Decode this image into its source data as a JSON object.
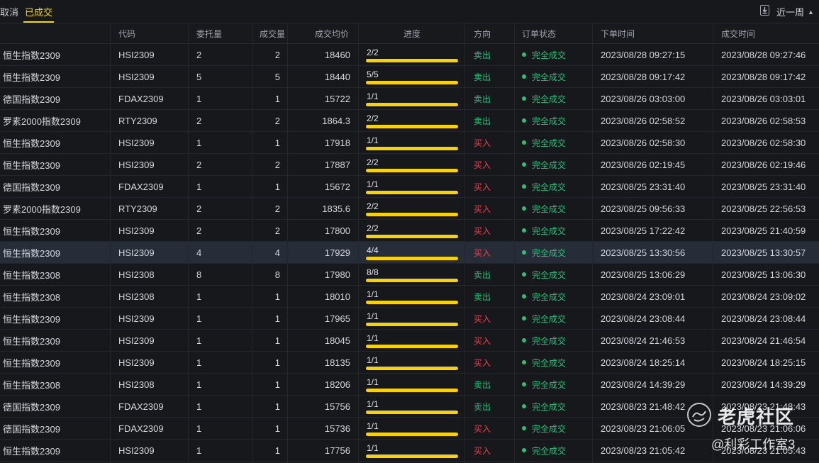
{
  "tabs": {
    "cancelled": "取消",
    "filled": "已成交"
  },
  "toolbar": {
    "export_icon": "download-icon",
    "period": "近一周",
    "period_caret": "▲"
  },
  "columns": {
    "name": "",
    "code": "代码",
    "order_qty": "委托量",
    "filled_qty": "成交量",
    "avg_price": "成交均价",
    "progress": "进度",
    "direction": "方向",
    "status": "订单状态",
    "placed_time": "下单时间",
    "filled_time": "成交时间"
  },
  "colors": {
    "accent": "#f3d21e",
    "sell": "#27c37a",
    "buy": "#f2404c",
    "progress": "#f5d10f"
  },
  "rows": [
    {
      "name": "恒生指数2309",
      "code": "HSI2309",
      "qty": "2",
      "filled": "2",
      "price": "18460",
      "progress": "2/2",
      "fill": 1,
      "dir": "卖出",
      "side": "sell",
      "status": "完全成交",
      "placed": "2023/08/28 09:27:15",
      "done": "2023/08/28 09:27:46",
      "selected": false
    },
    {
      "name": "恒生指数2309",
      "code": "HSI2309",
      "qty": "5",
      "filled": "5",
      "price": "18440",
      "progress": "5/5",
      "fill": 1,
      "dir": "卖出",
      "side": "sell",
      "status": "完全成交",
      "placed": "2023/08/28 09:17:42",
      "done": "2023/08/28 09:17:42",
      "selected": false
    },
    {
      "name": "德国指数2309",
      "code": "FDAX2309",
      "qty": "1",
      "filled": "1",
      "price": "15722",
      "progress": "1/1",
      "fill": 1,
      "dir": "卖出",
      "side": "sell",
      "status": "完全成交",
      "placed": "2023/08/26 03:03:00",
      "done": "2023/08/26 03:03:01",
      "selected": false
    },
    {
      "name": "罗素2000指数2309",
      "code": "RTY2309",
      "qty": "2",
      "filled": "2",
      "price": "1864.3",
      "progress": "2/2",
      "fill": 1,
      "dir": "卖出",
      "side": "sell",
      "status": "完全成交",
      "placed": "2023/08/26 02:58:52",
      "done": "2023/08/26 02:58:53",
      "selected": false
    },
    {
      "name": "恒生指数2309",
      "code": "HSI2309",
      "qty": "1",
      "filled": "1",
      "price": "17918",
      "progress": "1/1",
      "fill": 1,
      "dir": "买入",
      "side": "buy",
      "status": "完全成交",
      "placed": "2023/08/26 02:58:30",
      "done": "2023/08/26 02:58:30",
      "selected": false
    },
    {
      "name": "恒生指数2309",
      "code": "HSI2309",
      "qty": "2",
      "filled": "2",
      "price": "17887",
      "progress": "2/2",
      "fill": 1,
      "dir": "买入",
      "side": "buy",
      "status": "完全成交",
      "placed": "2023/08/26 02:19:45",
      "done": "2023/08/26 02:19:46",
      "selected": false
    },
    {
      "name": "德国指数2309",
      "code": "FDAX2309",
      "qty": "1",
      "filled": "1",
      "price": "15672",
      "progress": "1/1",
      "fill": 1,
      "dir": "买入",
      "side": "buy",
      "status": "完全成交",
      "placed": "2023/08/25 23:31:40",
      "done": "2023/08/25 23:31:40",
      "selected": false
    },
    {
      "name": "罗素2000指数2309",
      "code": "RTY2309",
      "qty": "2",
      "filled": "2",
      "price": "1835.6",
      "progress": "2/2",
      "fill": 1,
      "dir": "买入",
      "side": "buy",
      "status": "完全成交",
      "placed": "2023/08/25 09:56:33",
      "done": "2023/08/25 22:56:53",
      "selected": false
    },
    {
      "name": "恒生指数2309",
      "code": "HSI2309",
      "qty": "2",
      "filled": "2",
      "price": "17800",
      "progress": "2/2",
      "fill": 1,
      "dir": "买入",
      "side": "buy",
      "status": "完全成交",
      "placed": "2023/08/25 17:22:42",
      "done": "2023/08/25 21:40:59",
      "selected": false
    },
    {
      "name": "恒生指数2309",
      "code": "HSI2309",
      "qty": "4",
      "filled": "4",
      "price": "17929",
      "progress": "4/4",
      "fill": 1,
      "dir": "买入",
      "side": "buy",
      "status": "完全成交",
      "placed": "2023/08/25 13:30:56",
      "done": "2023/08/25 13:30:57",
      "selected": true
    },
    {
      "name": "恒生指数2308",
      "code": "HSI2308",
      "qty": "8",
      "filled": "8",
      "price": "17980",
      "progress": "8/8",
      "fill": 1,
      "dir": "卖出",
      "side": "sell",
      "status": "完全成交",
      "placed": "2023/08/25 13:06:29",
      "done": "2023/08/25 13:06:30",
      "selected": false
    },
    {
      "name": "恒生指数2308",
      "code": "HSI2308",
      "qty": "1",
      "filled": "1",
      "price": "18010",
      "progress": "1/1",
      "fill": 1,
      "dir": "卖出",
      "side": "sell",
      "status": "完全成交",
      "placed": "2023/08/24 23:09:01",
      "done": "2023/08/24 23:09:02",
      "selected": false
    },
    {
      "name": "恒生指数2309",
      "code": "HSI2309",
      "qty": "1",
      "filled": "1",
      "price": "17965",
      "progress": "1/1",
      "fill": 1,
      "dir": "买入",
      "side": "buy",
      "status": "完全成交",
      "placed": "2023/08/24 23:08:44",
      "done": "2023/08/24 23:08:44",
      "selected": false
    },
    {
      "name": "恒生指数2309",
      "code": "HSI2309",
      "qty": "1",
      "filled": "1",
      "price": "18045",
      "progress": "1/1",
      "fill": 1,
      "dir": "买入",
      "side": "buy",
      "status": "完全成交",
      "placed": "2023/08/24 21:46:53",
      "done": "2023/08/24 21:46:54",
      "selected": false
    },
    {
      "name": "恒生指数2309",
      "code": "HSI2309",
      "qty": "1",
      "filled": "1",
      "price": "18135",
      "progress": "1/1",
      "fill": 1,
      "dir": "买入",
      "side": "buy",
      "status": "完全成交",
      "placed": "2023/08/24 18:25:14",
      "done": "2023/08/24 18:25:15",
      "selected": false
    },
    {
      "name": "恒生指数2308",
      "code": "HSI2308",
      "qty": "1",
      "filled": "1",
      "price": "18206",
      "progress": "1/1",
      "fill": 1,
      "dir": "卖出",
      "side": "sell",
      "status": "完全成交",
      "placed": "2023/08/24 14:39:29",
      "done": "2023/08/24 14:39:29",
      "selected": false
    },
    {
      "name": "德国指数2309",
      "code": "FDAX2309",
      "qty": "1",
      "filled": "1",
      "price": "15756",
      "progress": "1/1",
      "fill": 1,
      "dir": "卖出",
      "side": "sell",
      "status": "完全成交",
      "placed": "2023/08/23 21:48:42",
      "done": "2023/08/23 21:48:43",
      "selected": false
    },
    {
      "name": "德国指数2309",
      "code": "FDAX2309",
      "qty": "1",
      "filled": "1",
      "price": "15736",
      "progress": "1/1",
      "fill": 1,
      "dir": "买入",
      "side": "buy",
      "status": "完全成交",
      "placed": "2023/08/23 21:06:05",
      "done": "2023/08/23 21:06:06",
      "selected": false
    },
    {
      "name": "恒生指数2309",
      "code": "HSI2309",
      "qty": "1",
      "filled": "1",
      "price": "17756",
      "progress": "1/1",
      "fill": 1,
      "dir": "买入",
      "side": "buy",
      "status": "完全成交",
      "placed": "2023/08/23 21:05:42",
      "done": "2023/08/23 21:05:43",
      "selected": false
    }
  ],
  "watermark": {
    "main": "老虎社区",
    "sub": "@利彩工作室3",
    "logo_icon": "tiger-logo-icon"
  }
}
